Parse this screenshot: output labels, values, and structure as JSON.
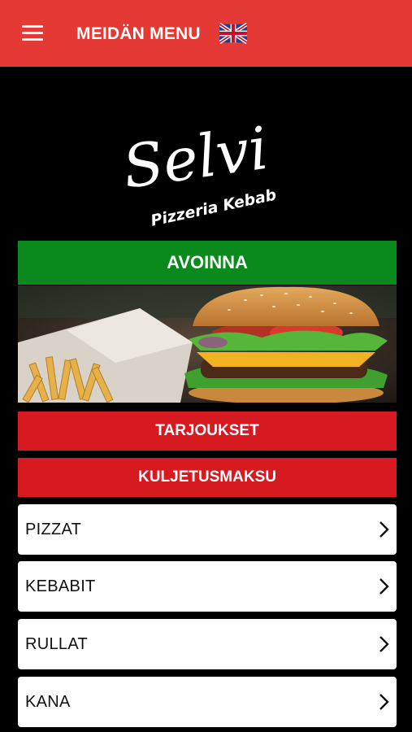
{
  "header": {
    "menu_icon": "hamburger-menu-icon",
    "title": "MEIDÄN MENU",
    "language_flag": "uk-flag-icon",
    "background_color": "#e53935"
  },
  "logo": {
    "name": "Selvi",
    "subtitle": "Pizzeria Kebab"
  },
  "status": {
    "label": "AVOINNA",
    "color": "#0a8a1c"
  },
  "hero_image": "burger-and-fries-photo",
  "buttons": {
    "offers": "TARJOUKSET",
    "delivery_fee": "KULJETUSMAKSU",
    "color": "#d71920"
  },
  "categories": [
    {
      "label": "PIZZAT"
    },
    {
      "label": "KEBABIT"
    },
    {
      "label": "RULLAT"
    },
    {
      "label": "KANA"
    }
  ],
  "chevron_icon": "chevron-right-icon"
}
